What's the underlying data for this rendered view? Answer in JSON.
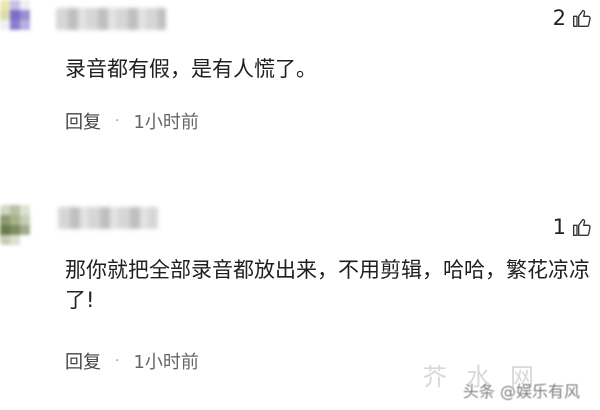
{
  "comments": [
    {
      "likes": "2",
      "text": "录音都有假，是有人慌了。",
      "reply_label": "回复",
      "separator": "·",
      "time": "1小时前"
    },
    {
      "likes": "1",
      "text": "那你就把全部录音都放出来，不用剪辑，哈哈，繁花凉凉了!",
      "reply_label": "回复",
      "separator": "·",
      "time": "1小时前"
    }
  ],
  "watermark": "头条 @娱乐有风",
  "watermark_bg": "芥 水 网",
  "colors": {
    "text": "#1f1f1f",
    "meta": "#555555",
    "avatar1": [
      "#7d6cc6",
      "#e6e6a8",
      "#c9c3e8"
    ],
    "avatar2": [
      "#6a7b4d",
      "#a6b08a",
      "#d9dccb"
    ]
  },
  "icons": [
    "thumbs-up-icon"
  ]
}
